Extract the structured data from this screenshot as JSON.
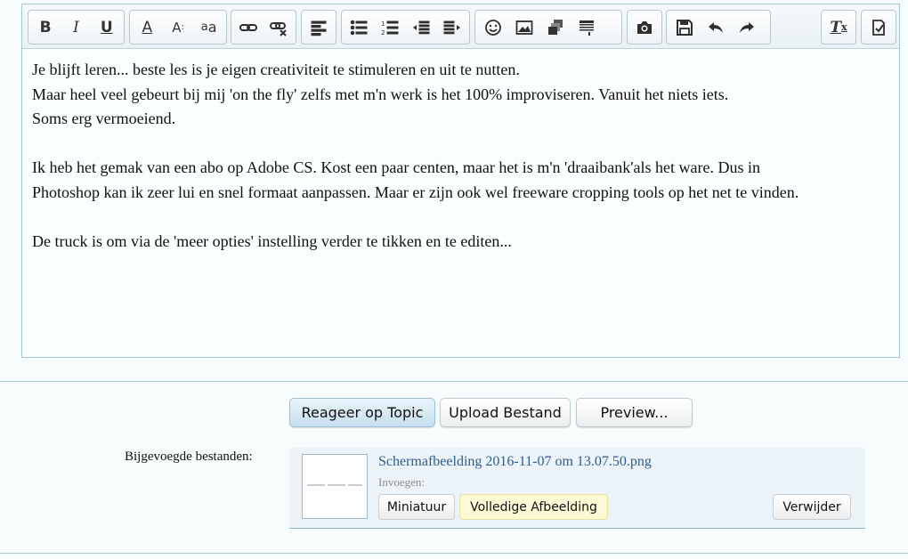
{
  "toolbar": {
    "groups": [
      [
        {
          "name": "bold-icon"
        },
        {
          "name": "italic-icon"
        },
        {
          "name": "underline-icon"
        }
      ],
      [
        {
          "name": "text-color-icon"
        },
        {
          "name": "font-size-icon"
        },
        {
          "name": "font-family-icon"
        }
      ],
      [
        {
          "name": "link-icon"
        },
        {
          "name": "unlink-icon"
        }
      ],
      [
        {
          "name": "align-left-icon"
        }
      ],
      [
        {
          "name": "bulleted-list-icon"
        },
        {
          "name": "numbered-list-icon"
        },
        {
          "name": "decrease-indent-icon"
        },
        {
          "name": "increase-indent-icon"
        }
      ],
      [
        {
          "name": "emoji-icon"
        },
        {
          "name": "image-icon"
        },
        {
          "name": "gallery-icon"
        },
        {
          "name": "table-icon"
        }
      ],
      [
        {
          "name": "camera-icon"
        }
      ],
      [
        {
          "name": "save-icon"
        },
        {
          "name": "undo-icon"
        },
        {
          "name": "redo-icon"
        }
      ],
      [
        {
          "name": "remove-format-icon"
        }
      ],
      [
        {
          "name": "source-toggle-icon"
        }
      ]
    ]
  },
  "editor": {
    "paragraphs": [
      [
        "Je blijft leren... beste les is je eigen creativiteit te stimuleren en uit te nutten.",
        "Maar heel veel gebeurt bij mij 'on the fly' zelfs met m'n werk is het 100% improviseren. Vanuit het niets iets.",
        "Soms erg vermoeiend."
      ],
      [
        "Ik heb het gemak van een abo op Adobe CS. Kost een paar centen, maar het is m'n 'draaibank'als het ware. Dus in",
        "Photoshop kan ik zeer lui en snel formaat aanpassen. Maar er zijn ook wel freeware cropping tools op het net te vinden."
      ],
      [
        "De truck is om via de 'meer opties' instelling verder te tikken en te editen..."
      ]
    ]
  },
  "actions": {
    "reply": "Reageer op Topic",
    "upload": "Upload Bestand",
    "preview": "Preview..."
  },
  "attachments": {
    "label": "Bijgevoegde bestanden:",
    "file_name": "Schermafbeelding 2016-11-07 om 13.07.50.png",
    "insert_label": "Invoegen:",
    "thumbnail_button": "Miniatuur",
    "full_image_button": "Volledige Afbeelding",
    "delete_button": "Verwijder"
  }
}
